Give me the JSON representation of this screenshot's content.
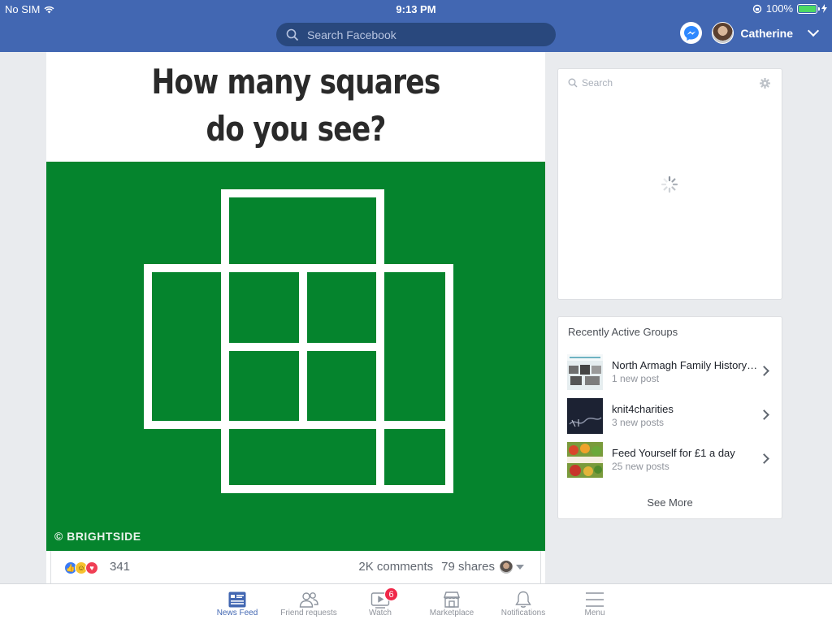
{
  "status_bar": {
    "carrier": "No SIM",
    "time": "9:13 PM",
    "battery": "100%"
  },
  "header": {
    "search_placeholder": "Search Facebook",
    "user_name": "Catherine"
  },
  "post": {
    "title_line1": "How many squares",
    "title_line2": "do you see?",
    "image_credit": "© BRIGHTSIDE",
    "image_bg_color": "#05842d",
    "reaction_count": "341",
    "comments": "2K comments",
    "shares": "79 shares"
  },
  "chat": {
    "search_placeholder": "Search"
  },
  "groups": {
    "title": "Recently Active Groups",
    "items": [
      {
        "name": "North Armagh Family History…",
        "sub": "1 new post"
      },
      {
        "name": "knit4charities",
        "sub": "3 new posts"
      },
      {
        "name": "Feed Yourself for £1 a day",
        "sub": "25 new posts"
      }
    ],
    "see_more": "See More"
  },
  "tabs": [
    {
      "label": "News Feed",
      "icon": "news-feed-icon",
      "active": true
    },
    {
      "label": "Friend requests",
      "icon": "friend-requests-icon"
    },
    {
      "label": "Watch",
      "icon": "watch-icon",
      "badge": "6"
    },
    {
      "label": "Marketplace",
      "icon": "marketplace-icon"
    },
    {
      "label": "Notifications",
      "icon": "bell-icon"
    },
    {
      "label": "Menu",
      "icon": "menu-icon"
    }
  ],
  "colors": {
    "brand": "#4267b2",
    "accent_dark": "#29487d",
    "badge": "#f02849"
  }
}
